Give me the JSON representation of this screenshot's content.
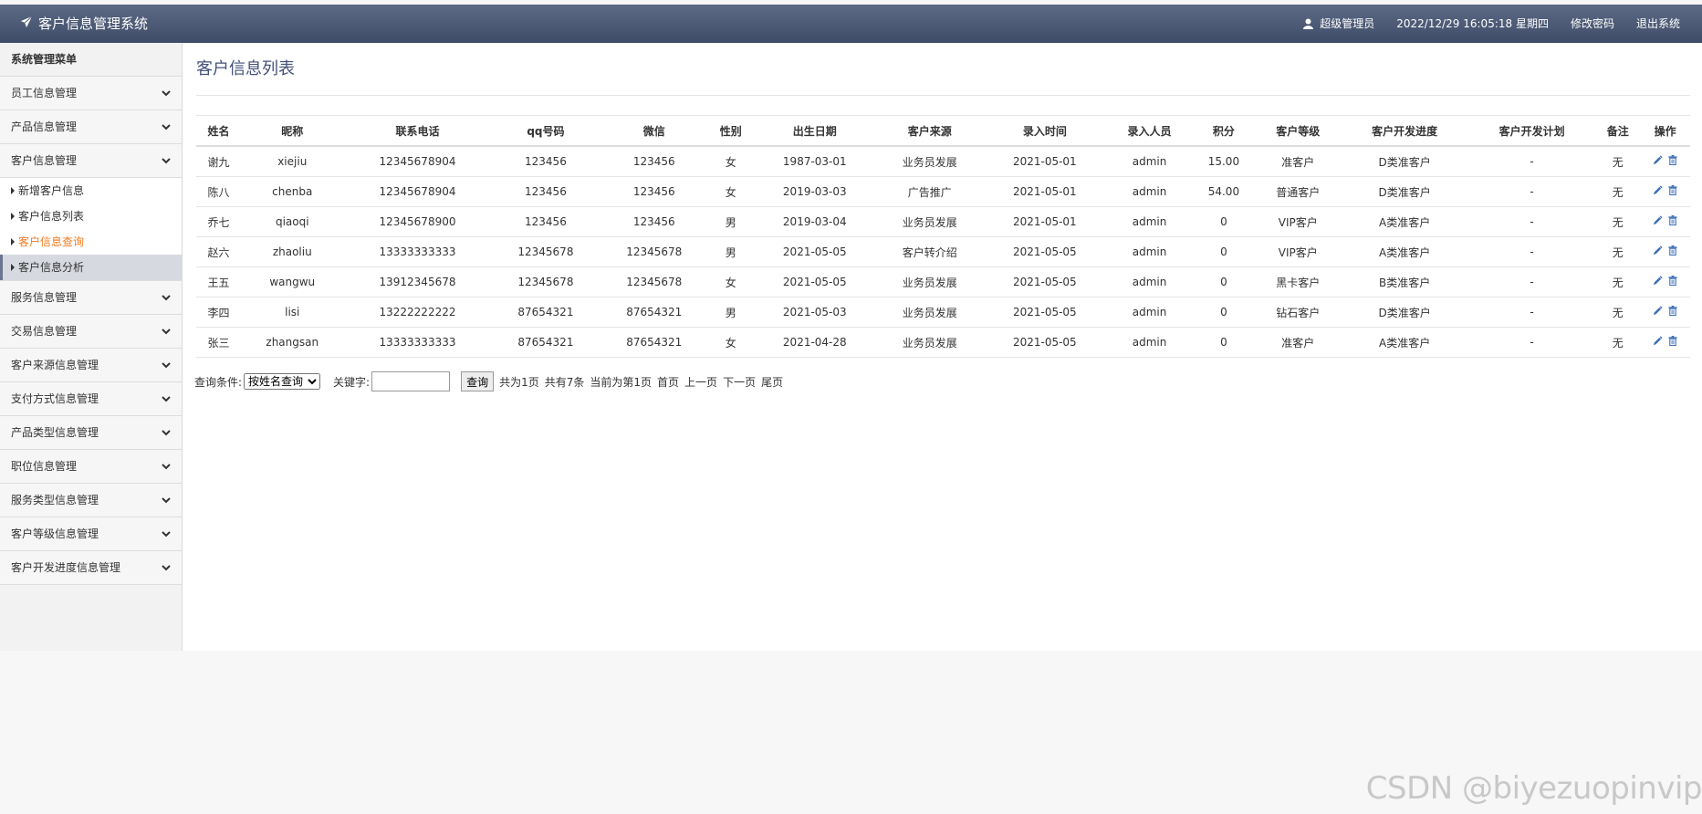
{
  "header": {
    "app_title": "客户信息管理系统",
    "user": "超级管理员",
    "datetime": "2022/12/29 16:05:18 星期四",
    "change_password": "修改密码",
    "logout": "退出系统"
  },
  "sidebar": {
    "title": "系统管理菜单",
    "groups": [
      {
        "label": "员工信息管理"
      },
      {
        "label": "产品信息管理"
      },
      {
        "label": "客户信息管理"
      },
      {
        "label": "服务信息管理"
      },
      {
        "label": "交易信息管理"
      },
      {
        "label": "客户来源信息管理"
      },
      {
        "label": "支付方式信息管理"
      },
      {
        "label": "产品类型信息管理"
      },
      {
        "label": "职位信息管理"
      },
      {
        "label": "服务类型信息管理"
      },
      {
        "label": "客户等级信息管理"
      },
      {
        "label": "客户开发进度信息管理"
      }
    ],
    "sub_items": [
      {
        "label": "新增客户信息"
      },
      {
        "label": "客户信息列表"
      },
      {
        "label": "客户信息查询"
      },
      {
        "label": "客户信息分析"
      }
    ]
  },
  "main": {
    "title": "客户信息列表",
    "columns": [
      "姓名",
      "昵称",
      "联系电话",
      "qq号码",
      "微信",
      "性别",
      "出生日期",
      "客户来源",
      "录入时间",
      "录入人员",
      "积分",
      "客户等级",
      "客户开发进度",
      "客户开发计划",
      "备注",
      "操作"
    ],
    "rows": [
      [
        "谢九",
        "xiejiu",
        "12345678904",
        "123456",
        "123456",
        "女",
        "1987-03-01",
        "业务员发展",
        "2021-05-01",
        "admin",
        "15.00",
        "准客户",
        "D类准客户",
        "-",
        "无"
      ],
      [
        "陈八",
        "chenba",
        "12345678904",
        "123456",
        "123456",
        "女",
        "2019-03-03",
        "广告推广",
        "2021-05-01",
        "admin",
        "54.00",
        "普通客户",
        "D类准客户",
        "-",
        "无"
      ],
      [
        "乔七",
        "qiaoqi",
        "12345678900",
        "123456",
        "123456",
        "男",
        "2019-03-04",
        "业务员发展",
        "2021-05-01",
        "admin",
        "0",
        "VIP客户",
        "A类准客户",
        "-",
        "无"
      ],
      [
        "赵六",
        "zhaoliu",
        "13333333333",
        "12345678",
        "12345678",
        "男",
        "2021-05-05",
        "客户转介绍",
        "2021-05-05",
        "admin",
        "0",
        "VIP客户",
        "A类准客户",
        "-",
        "无"
      ],
      [
        "王五",
        "wangwu",
        "13912345678",
        "12345678",
        "12345678",
        "女",
        "2021-05-05",
        "业务员发展",
        "2021-05-05",
        "admin",
        "0",
        "黑卡客户",
        "B类准客户",
        "-",
        "无"
      ],
      [
        "李四",
        "lisi",
        "13222222222",
        "87654321",
        "87654321",
        "男",
        "2021-05-03",
        "业务员发展",
        "2021-05-05",
        "admin",
        "0",
        "钻石客户",
        "D类准客户",
        "-",
        "无"
      ],
      [
        "张三",
        "zhangsan",
        "13333333333",
        "87654321",
        "87654321",
        "女",
        "2021-04-28",
        "业务员发展",
        "2021-05-05",
        "admin",
        "0",
        "准客户",
        "A类准客户",
        "-",
        "无"
      ]
    ]
  },
  "search": {
    "condition_label": "查询条件:",
    "condition_value": "按姓名查询",
    "keyword_label": "关键字:",
    "button": "查询",
    "total_pages": "共为1页",
    "total_records": "共有7条",
    "current_page": "当前为第1页",
    "first": "首页",
    "prev": "上一页",
    "next": "下一页",
    "last": "尾页"
  },
  "watermark": "CSDN @biyezuopinvip",
  "colors": {
    "header": "#4b5774",
    "active_link": "#f27c22",
    "title": "#44517a",
    "icon": "#3c6fb5"
  }
}
